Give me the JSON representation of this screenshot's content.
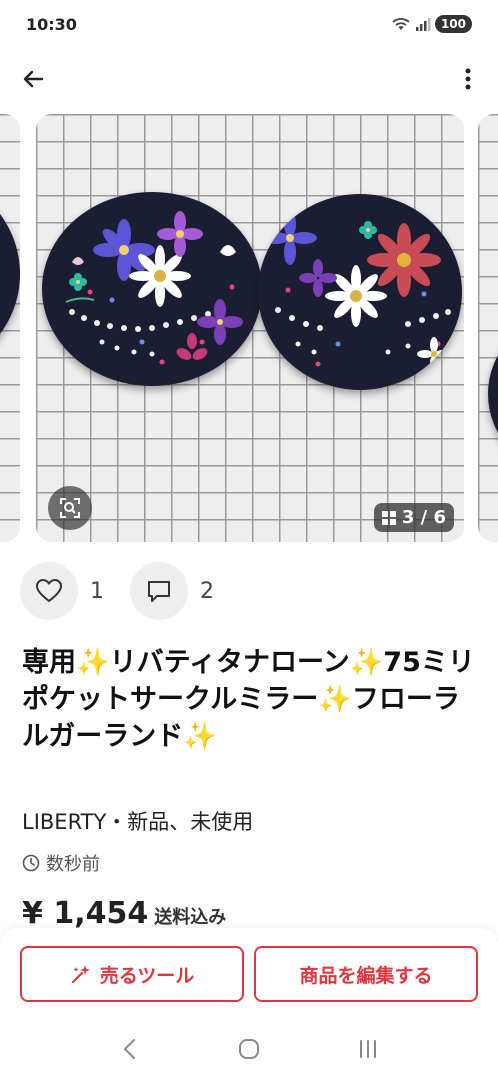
{
  "status": {
    "time": "10:30",
    "battery": "100"
  },
  "gallery": {
    "counter": "3 / 6"
  },
  "actions": {
    "likes": "1",
    "comments": "2"
  },
  "item": {
    "title_parts": [
      "専用",
      "リバティタナローン",
      "75ミリポケットサークルミラー",
      "フローラルガーランド"
    ],
    "spark": "✨",
    "meta": "LIBERTY・新品、未使用",
    "posted": "数秒前",
    "price": "¥ 1,454",
    "price_note": "送料込み"
  },
  "buttons": {
    "sell": "売るツール",
    "edit": "商品を編集する"
  },
  "colors": {
    "accent": "#e0373f",
    "fabric": "#1b1d33"
  },
  "icons": [
    "back-arrow-icon",
    "more-vert-icon",
    "zoom-icon",
    "grid-icon",
    "heart-icon",
    "comment-icon",
    "clock-icon",
    "sparkle-wand-icon",
    "wifi-icon",
    "signal-icon"
  ]
}
